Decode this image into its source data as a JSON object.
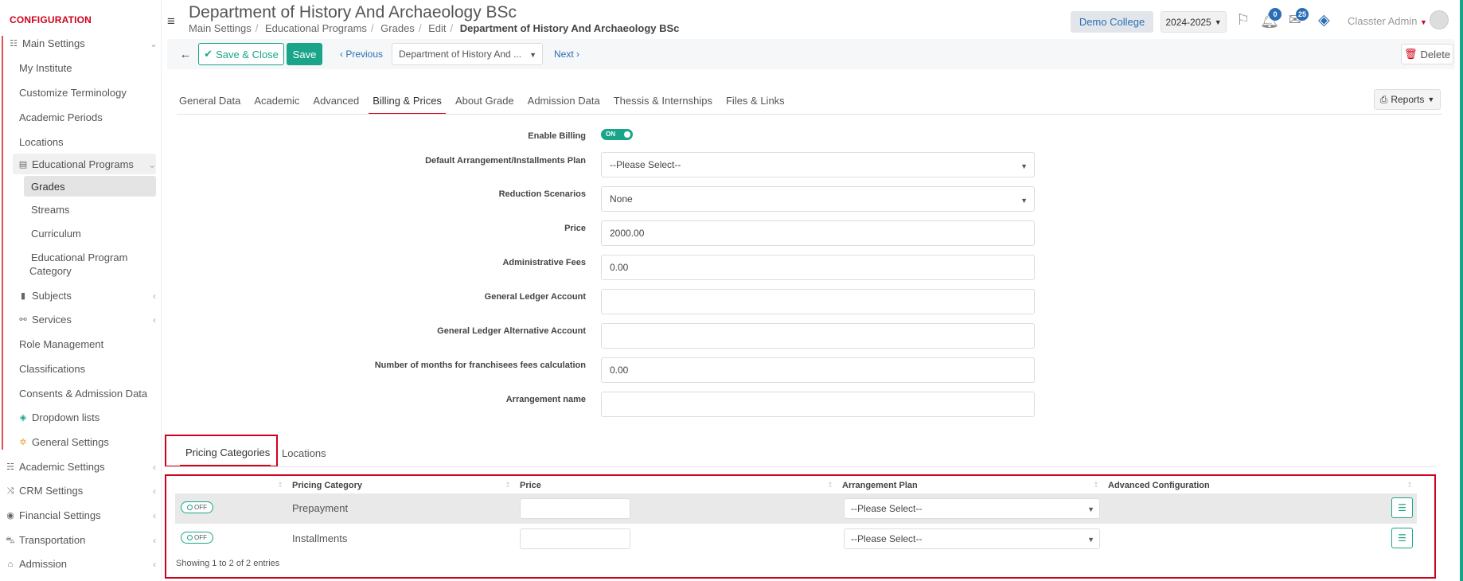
{
  "sidebar": {
    "heading": "CONFIGURATION",
    "main_settings": "Main Settings",
    "items": [
      {
        "label": "My Institute"
      },
      {
        "label": "Customize Terminology"
      },
      {
        "label": "Academic Periods"
      },
      {
        "label": "Locations"
      }
    ],
    "educational_programs": "Educational Programs",
    "sub_items": [
      {
        "label": "Grades"
      },
      {
        "label": "Streams"
      },
      {
        "label": "Curriculum"
      },
      {
        "label": "Educational Program"
      },
      {
        "label": "Category"
      }
    ],
    "subjects": "Subjects",
    "services": "Services",
    "role_management": "Role Management",
    "classifications": "Classifications",
    "consents": "Consents & Admission Data",
    "dropdown_lists": "Dropdown lists",
    "general_settings": "General Settings",
    "groups": [
      {
        "label": "Academic Settings"
      },
      {
        "label": "CRM Settings"
      },
      {
        "label": "Financial Settings"
      },
      {
        "label": "Transportation"
      },
      {
        "label": "Admission"
      }
    ]
  },
  "header": {
    "title": "Department of History And Archaeology BSc",
    "breadcrumb": [
      "Main Settings",
      "Educational Programs",
      "Grades",
      "Edit"
    ],
    "breadcrumb_current": "Department of History And Archaeology BSc",
    "college": "Demo College",
    "year": "2024-2025",
    "notifications_count": "0",
    "messages_count": "25",
    "user": "Classter Admin"
  },
  "toolbar": {
    "save_close": "Save & Close",
    "save": "Save",
    "previous": "Previous",
    "record_select": "Department of History And ...",
    "next": "Next",
    "delete": "Delete"
  },
  "tabs": [
    {
      "label": "General Data"
    },
    {
      "label": "Academic"
    },
    {
      "label": "Advanced"
    },
    {
      "label": "Billing & Prices"
    },
    {
      "label": "About Grade"
    },
    {
      "label": "Admission Data"
    },
    {
      "label": "Thessis & Internships"
    },
    {
      "label": "Files & Links"
    }
  ],
  "reports": "Reports",
  "form": {
    "enable_billing_label": "Enable Billing",
    "enable_billing_value": "ON",
    "default_plan_label": "Default Arrangement/Installments Plan",
    "default_plan_value": "--Please Select--",
    "reduction_label": "Reduction Scenarios",
    "reduction_value": "None",
    "price_label": "Price",
    "price_value": "2000.00",
    "admin_fees_label": "Administrative Fees",
    "admin_fees_value": "0.00",
    "gl_account_label": "General Ledger Account",
    "gl_account_value": "",
    "gl_alt_label": "General Ledger Alternative Account",
    "gl_alt_value": "",
    "months_label": "Number of months for franchisees fees calculation",
    "months_value": "0.00",
    "arrangement_label": "Arrangement name",
    "arrangement_value": ""
  },
  "subtabs": {
    "pricing": "Pricing Categories",
    "locations": "Locations"
  },
  "table": {
    "headers": {
      "category": "Pricing Category",
      "price": "Price",
      "plan": "Arrangement Plan",
      "advanced": "Advanced Configuration"
    },
    "rows": [
      {
        "toggle": "OFF",
        "category": "Prepayment",
        "plan": "--Please Select--"
      },
      {
        "toggle": "OFF",
        "category": "Installments",
        "plan": "--Please Select--"
      }
    ],
    "footer": "Showing 1 to 2 of 2 entries"
  },
  "colors": {
    "accent": "#1aa58a",
    "brand_red": "#d0021b",
    "link": "#2a6eb5"
  }
}
